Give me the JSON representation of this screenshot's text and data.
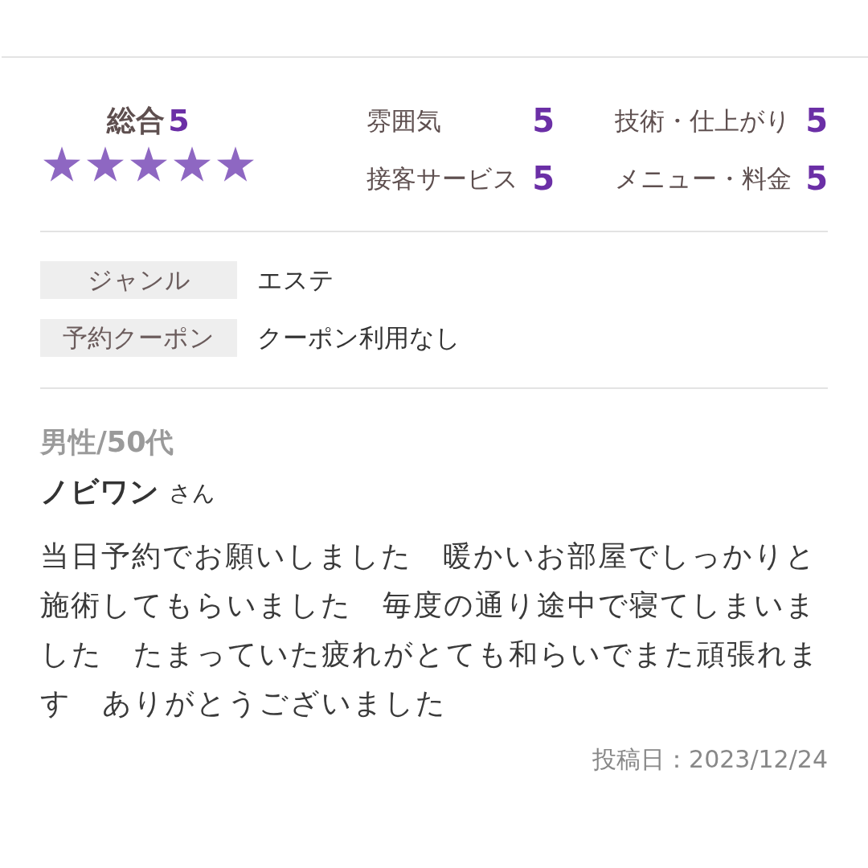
{
  "ratings": {
    "overall": {
      "label": "総合",
      "value": "5",
      "stars": 5
    },
    "items": [
      {
        "label": "雰囲気",
        "value": "5"
      },
      {
        "label": "技術・仕上がり",
        "value": "5"
      },
      {
        "label": "接客サービス",
        "value": "5"
      },
      {
        "label": "メニュー・料金",
        "value": "5"
      }
    ]
  },
  "details": [
    {
      "label": "ジャンル",
      "value": "エステ"
    },
    {
      "label": "予約クーポン",
      "value": "クーポン利用なし"
    }
  ],
  "review": {
    "reviewer_profile": "男性/50代",
    "reviewer_name": "ノビワン",
    "honorific": "さん",
    "text": "当日予約でお願いしました　暖かいお部屋でしっかりと施術してもらいました　毎度の通り途中で寝てしまいました　たまっていた疲れがとても和らいでまた頑張れます　ありがとうございました",
    "posted_date": "投稿日：2023/12/24"
  }
}
